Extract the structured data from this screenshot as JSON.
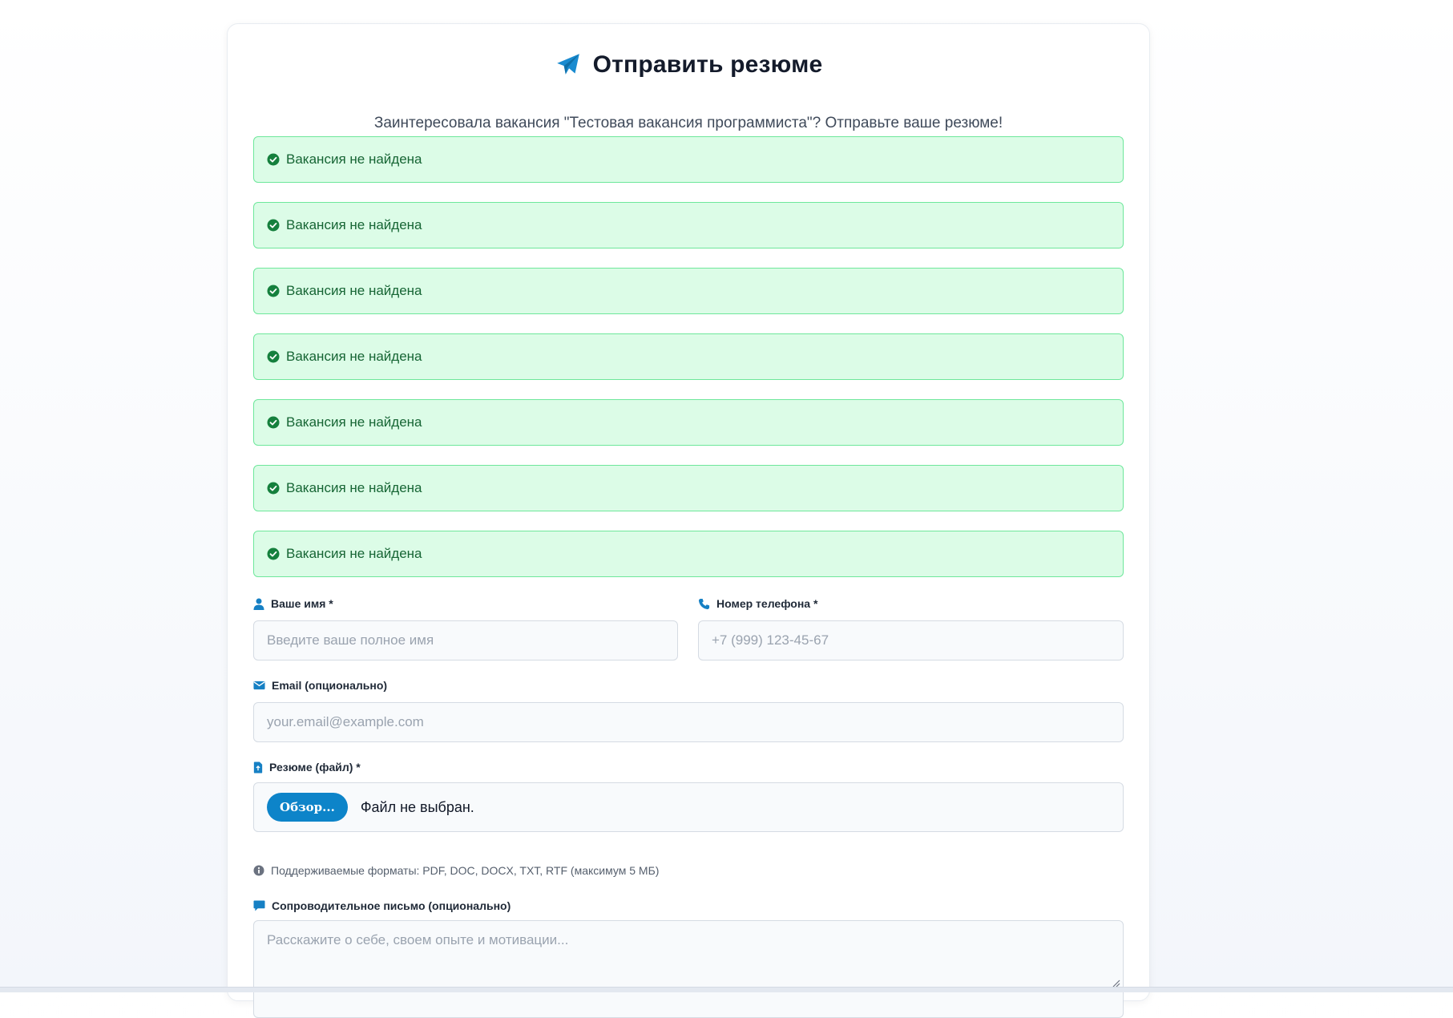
{
  "header": {
    "title": "Отправить резюме",
    "subtitle": "Заинтересовала вакансия \"Тестовая вакансия программиста\"? Отправьте ваше резюме!",
    "icon": "paper-plane-icon"
  },
  "alerts": [
    {
      "text": "Вакансия не найдена",
      "icon": "check-circle-icon"
    },
    {
      "text": "Вакансия не найдена",
      "icon": "check-circle-icon"
    },
    {
      "text": "Вакансия не найдена",
      "icon": "check-circle-icon"
    },
    {
      "text": "Вакансия не найдена",
      "icon": "check-circle-icon"
    },
    {
      "text": "Вакансия не найдена",
      "icon": "check-circle-icon"
    },
    {
      "text": "Вакансия не найдена",
      "icon": "check-circle-icon"
    },
    {
      "text": "Вакансия не найдена",
      "icon": "check-circle-icon"
    }
  ],
  "form": {
    "name": {
      "label": "Ваше имя *",
      "placeholder": "Введите ваше полное имя",
      "value": "",
      "icon": "user-icon"
    },
    "phone": {
      "label": "Номер телефона *",
      "placeholder": "+7 (999) 123-45-67",
      "value": "",
      "icon": "phone-icon"
    },
    "email": {
      "label": "Email (опционально)",
      "placeholder": "your.email@example.com",
      "value": "",
      "icon": "envelope-icon"
    },
    "resume": {
      "label": "Резюме (файл) *",
      "button": "Обзор...",
      "status": "Файл не выбран.",
      "icon": "file-icon"
    },
    "hint": {
      "text": "Поддерживаемые форматы: PDF, DOC, DOCX, TXT, RTF (максимум 5 МБ)",
      "icon": "info-circle-icon"
    },
    "cover_letter": {
      "label": "Сопроводительное письмо (опционально)",
      "placeholder": "Расскажите о себе, своем опыте и мотивации...",
      "value": "",
      "icon": "comment-icon"
    }
  },
  "colors": {
    "accent": "#0d84c9",
    "alert_bg": "#dcfce7",
    "alert_border": "#6ee79b",
    "alert_text": "#166534"
  }
}
